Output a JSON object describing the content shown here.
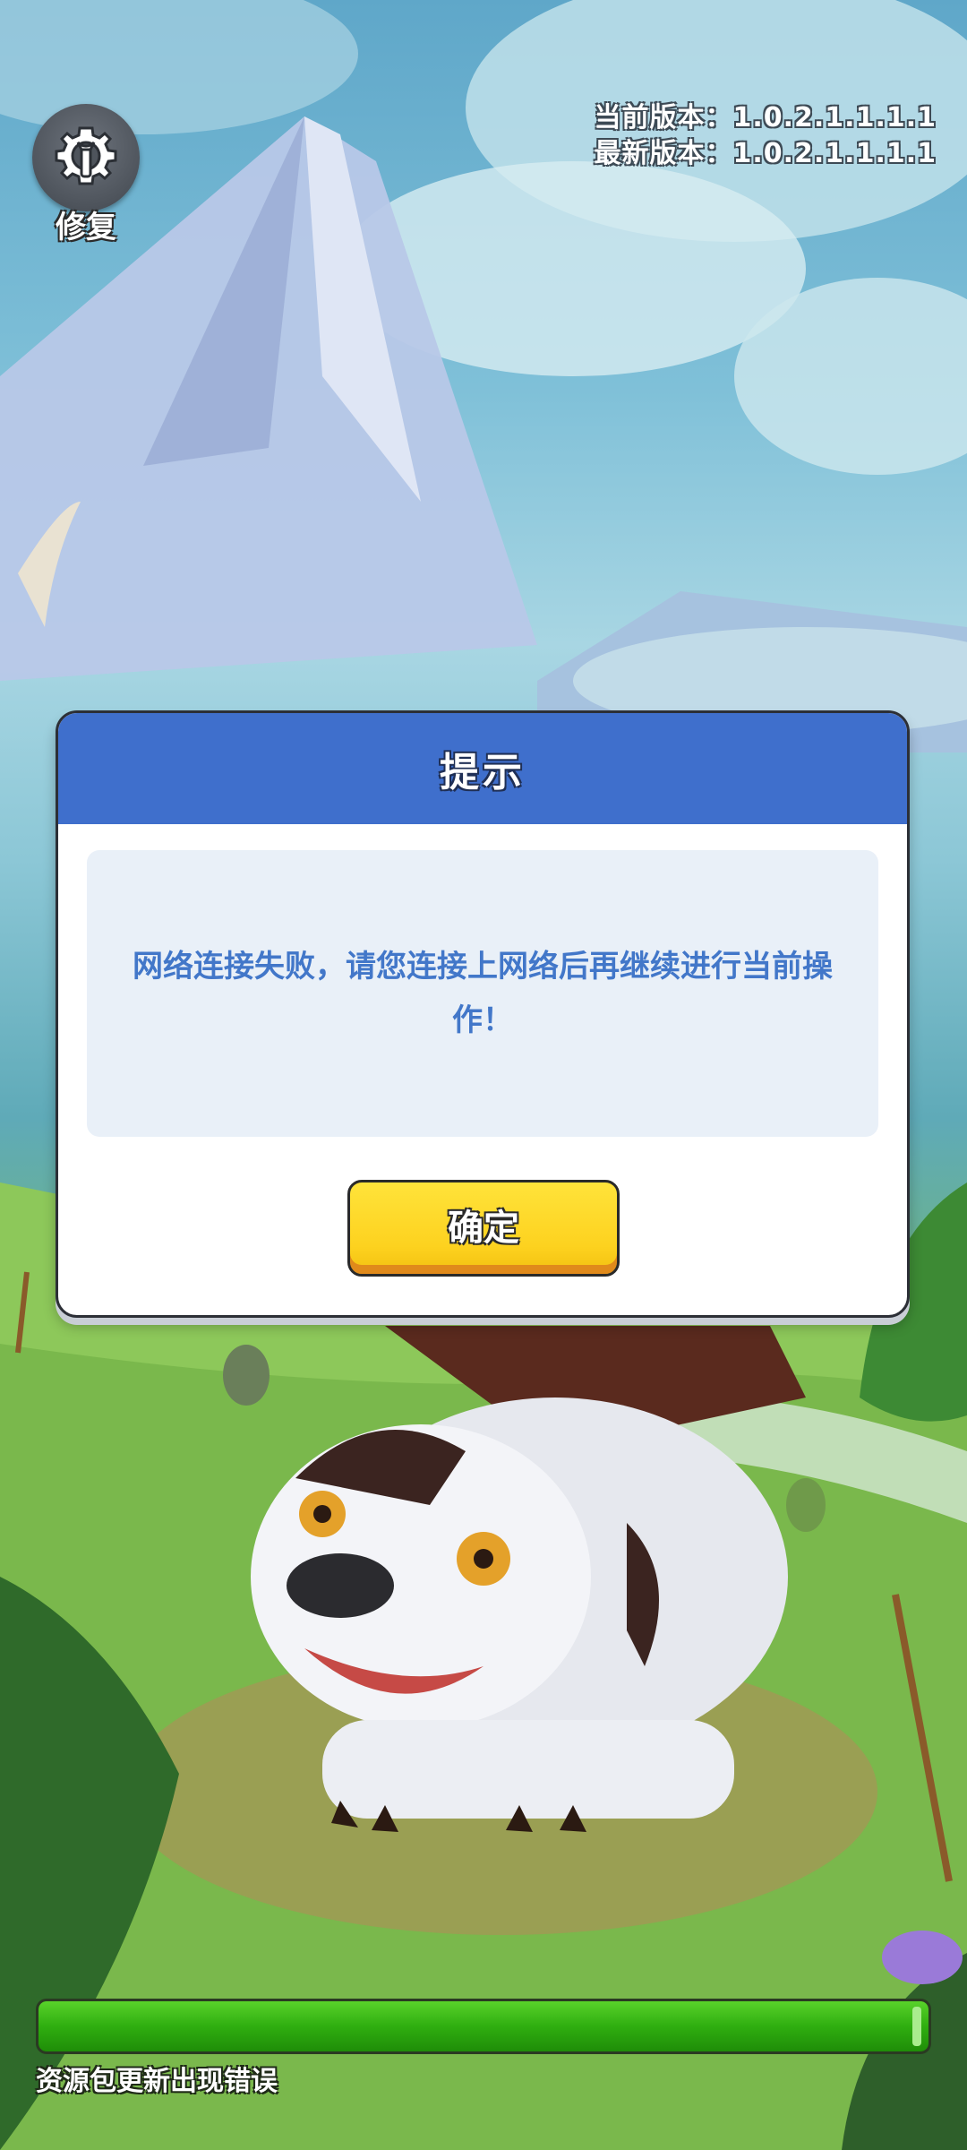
{
  "repair": {
    "label": "修复",
    "icon": "gear-wrench-icon"
  },
  "version": {
    "current_label": "当前版本：",
    "current_value": "1.0.2.1.1.1.1",
    "latest_label": "最新版本：",
    "latest_value": "1.0.2.1.1.1.1"
  },
  "dialog": {
    "title": "提示",
    "message": "网络连接失败，请您连接上网络后再继续进行当前操作！",
    "confirm_label": "确定"
  },
  "progress": {
    "fraction": 1.0,
    "status_text": "资源包更新出现错误"
  },
  "colors": {
    "dialog_header": "#3f6fcc",
    "message_text": "#4277c9",
    "confirm_button": "#fdd21f",
    "progress_fill": "#2fae10"
  }
}
